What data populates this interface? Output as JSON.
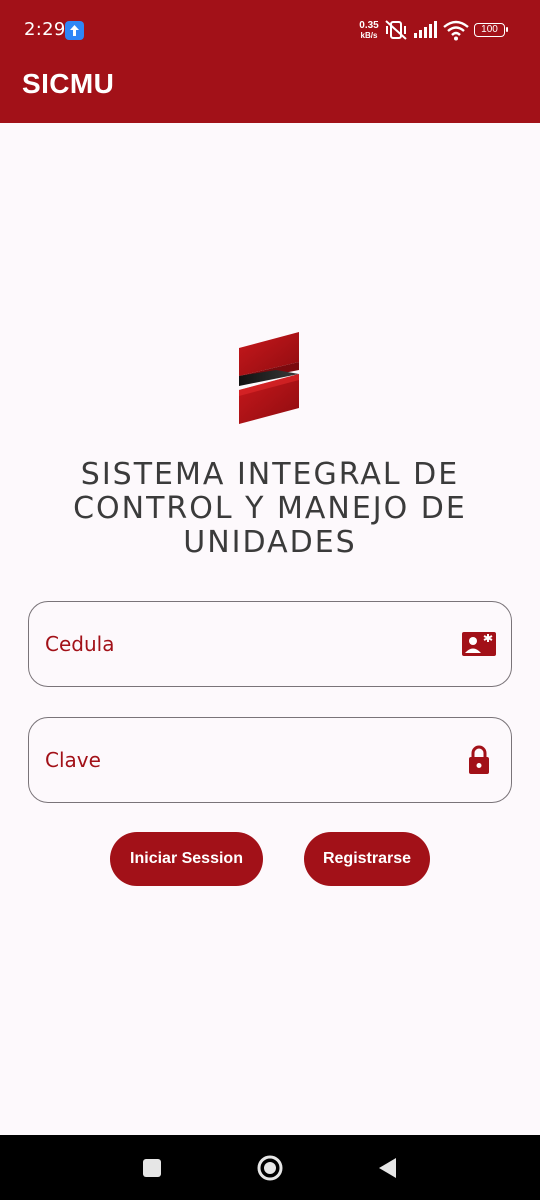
{
  "status_bar": {
    "time": "2:29",
    "net_speed_value": "0.35",
    "net_speed_unit": "kB/s",
    "battery": "100",
    "icons": [
      "upload-icon",
      "vibrate-icon",
      "signal-icon",
      "wifi-icon",
      "battery-icon"
    ]
  },
  "app_bar": {
    "title": "SICMU"
  },
  "logo": {
    "icon": "sicmu-logo-icon"
  },
  "system_title": {
    "line1": "SISTEMA INTEGRAL DE",
    "line2": "CONTROL Y MANEJO DE",
    "line3": "UNIDADES"
  },
  "form": {
    "cedula": {
      "placeholder": "Cedula",
      "value": "",
      "icon": "id-card-icon"
    },
    "clave": {
      "placeholder": "Clave",
      "value": "",
      "icon": "lock-icon"
    },
    "login_label": "Iniciar Session",
    "register_label": "Registrarse"
  },
  "nav_bar": {
    "icons": [
      "recents-icon",
      "home-icon",
      "back-icon"
    ]
  },
  "colors": {
    "primary": "#a21118",
    "background": "#fdf9fc",
    "text_dark": "#3b3b3b",
    "field_border": "#7a7479"
  }
}
